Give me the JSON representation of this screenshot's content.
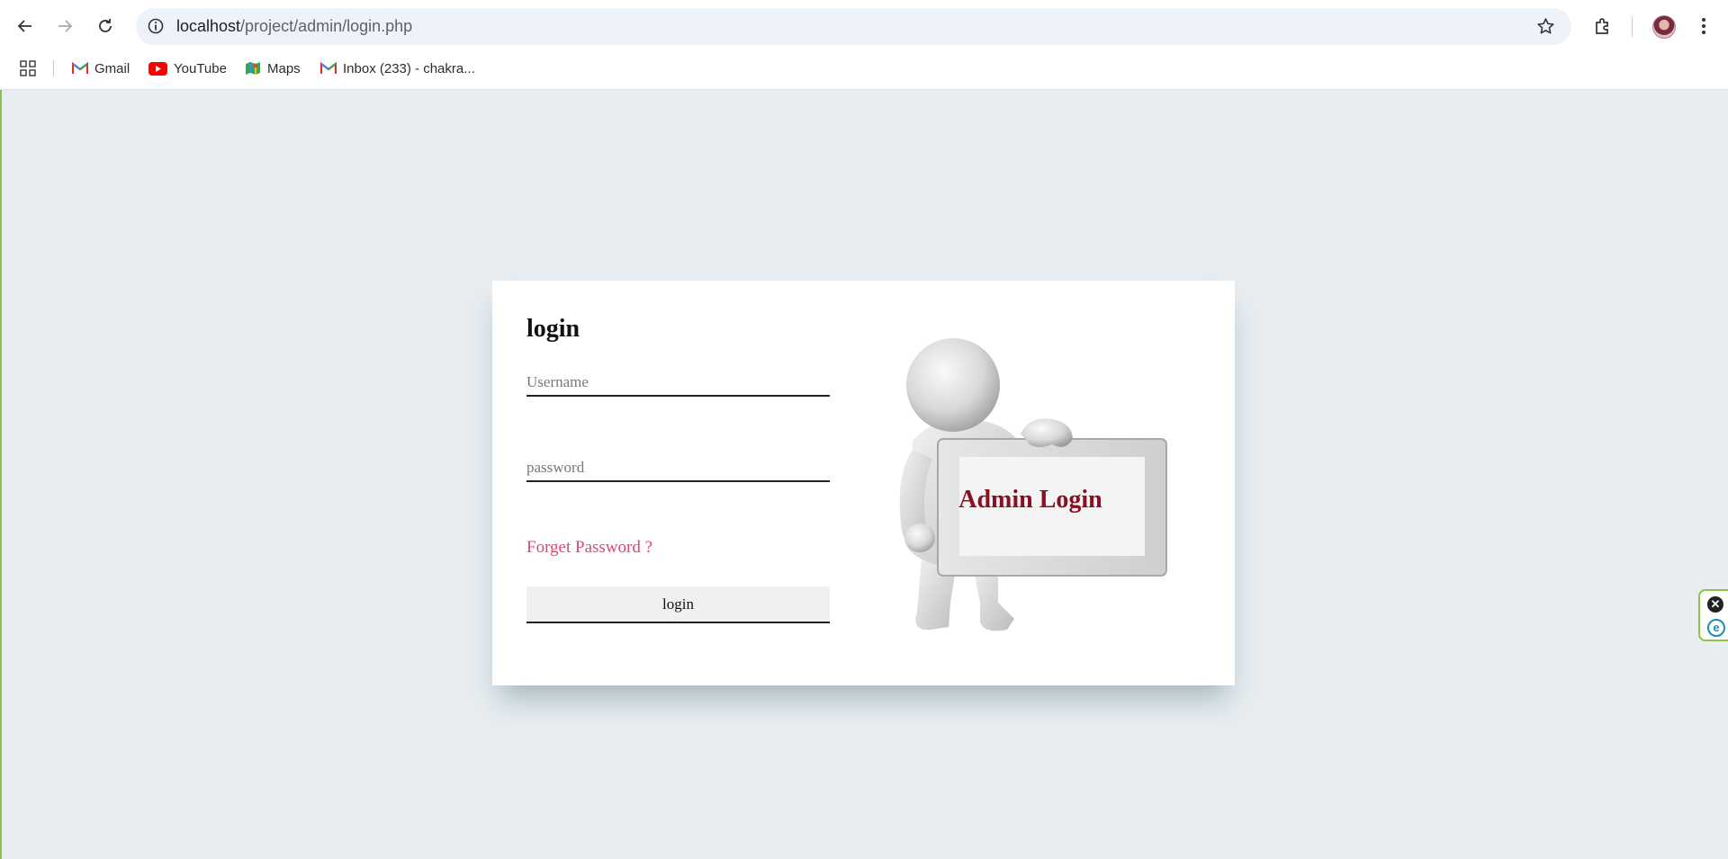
{
  "browser": {
    "url_host": "localhost",
    "url_path": "/project/admin/login.php",
    "bookmarks": [
      {
        "label": "Gmail",
        "icon": "gmail-icon"
      },
      {
        "label": "YouTube",
        "icon": "youtube-icon"
      },
      {
        "label": "Maps",
        "icon": "maps-icon"
      },
      {
        "label": "Inbox (233) - chakra...",
        "icon": "gmail-icon"
      }
    ]
  },
  "login": {
    "title": "login",
    "username_placeholder": "Username",
    "password_placeholder": "password",
    "forget_label": "Forget Password ?",
    "submit_label": "login",
    "sign_text": "Admin Login"
  },
  "side_widget": {
    "close_glyph": "✕",
    "ext_glyph": "e"
  },
  "colors": {
    "page_bg": "#e8edf1",
    "forget_link": "#e0476e",
    "sign_text": "#8b0f22",
    "accent_green": "#8bc34a"
  }
}
